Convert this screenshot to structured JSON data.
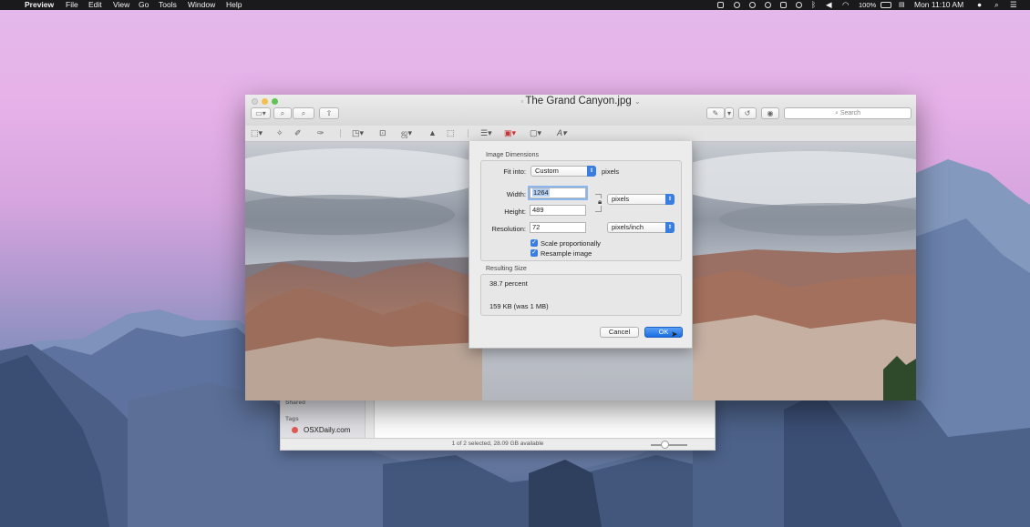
{
  "menubar": {
    "app": "Preview",
    "items": [
      "File",
      "Edit",
      "View",
      "Go",
      "Tools",
      "Window",
      "Help"
    ],
    "battery": "100%",
    "clock": "Mon 11:10 AM"
  },
  "preview": {
    "title": "The Grand Canyon.jpg",
    "title_suffix": "⌄",
    "search_placeholder": "Search"
  },
  "dialog": {
    "dimensions_title": "Image Dimensions",
    "fit_label": "Fit into:",
    "fit_value": "Custom",
    "fit_unit": "pixels",
    "width_label": "Width:",
    "width_value": "1264",
    "height_label": "Height:",
    "height_value": "489",
    "size_unit": "pixels",
    "resolution_label": "Resolution:",
    "resolution_value": "72",
    "resolution_unit": "pixels/inch",
    "scale_label": "Scale proportionally",
    "resample_label": "Resample image",
    "scale_checked": true,
    "resample_checked": true,
    "resulting_title": "Resulting Size",
    "percent": "38.7 percent",
    "filesize": "159 KB (was 1 MB)",
    "cancel": "Cancel",
    "ok": "OK"
  },
  "finder": {
    "shared_label": "Shared",
    "tags_label": "Tags",
    "tag_item": "OSXDaily.com",
    "status": "1 of 2 selected, 28.09 GB available"
  },
  "colors": {
    "accent": "#3a7de0",
    "tag_red": "#e65a55"
  }
}
